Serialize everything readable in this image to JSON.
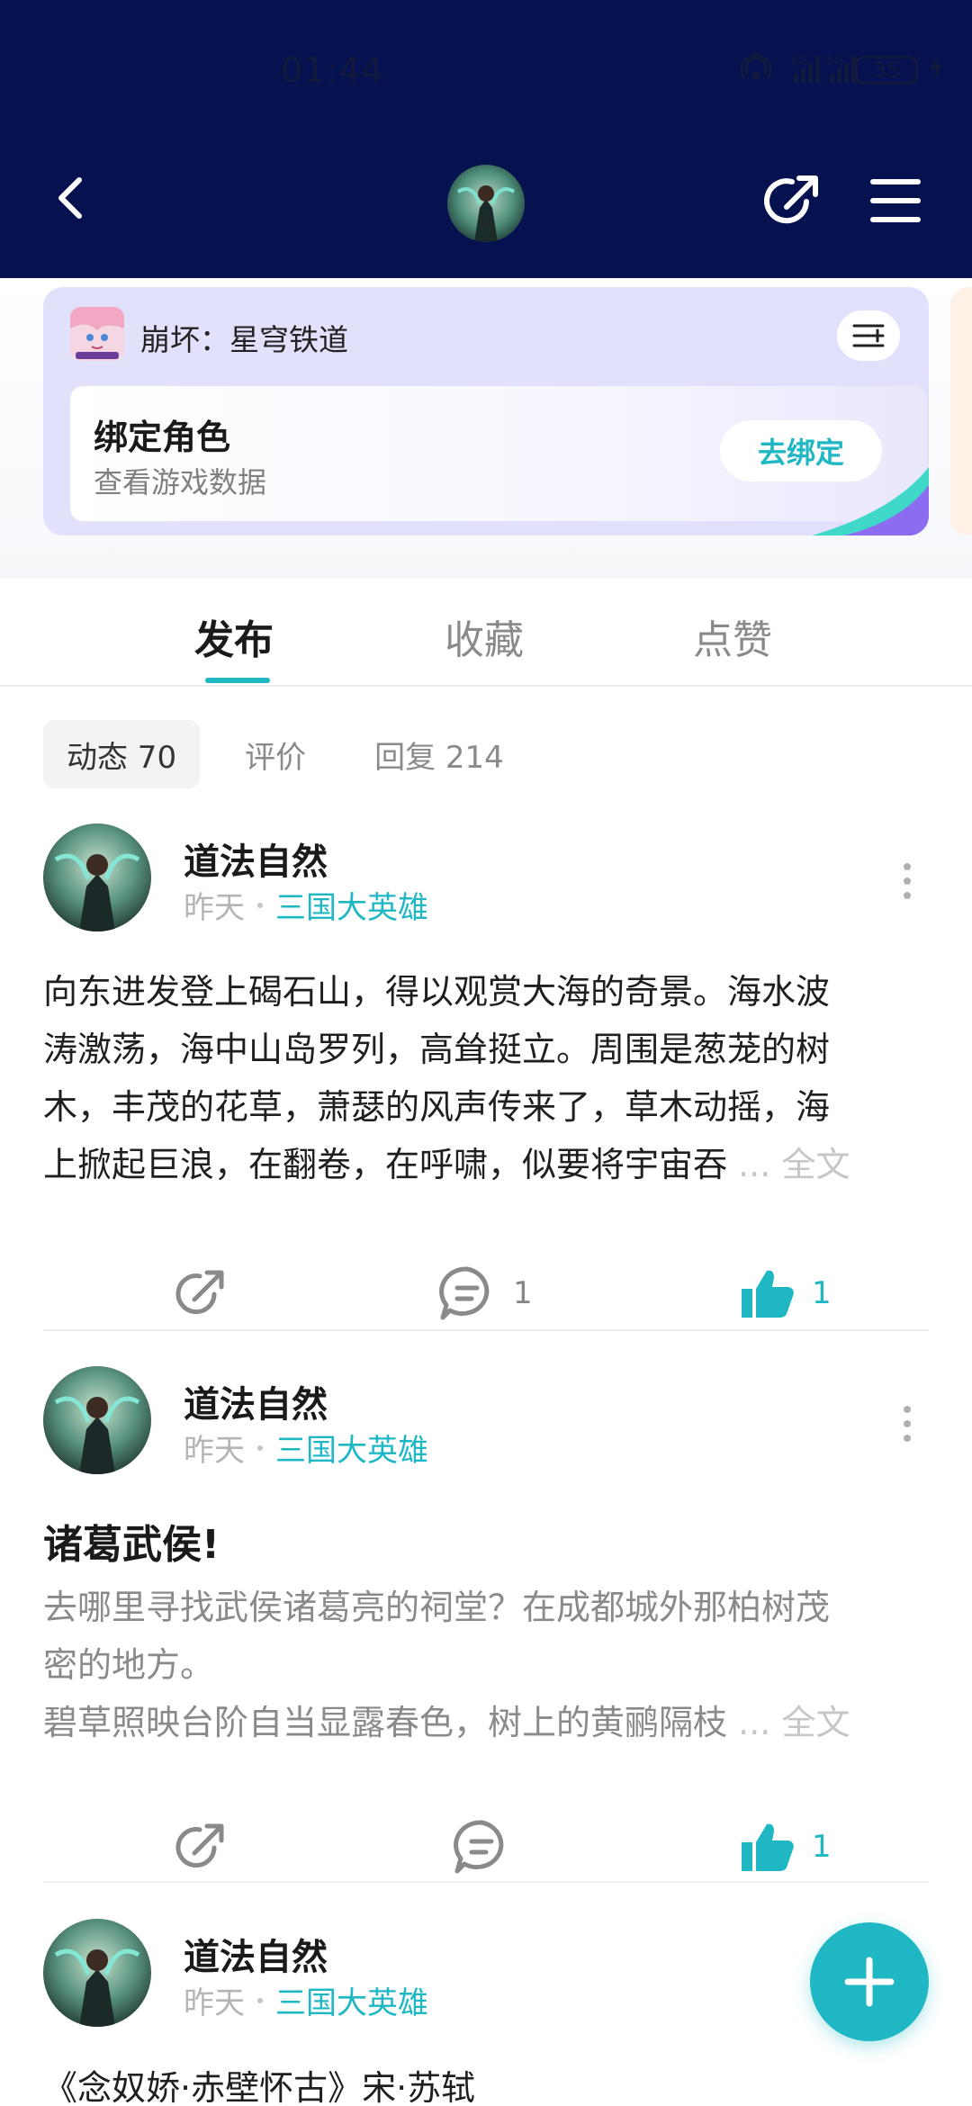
{
  "status": {
    "time": "01:44",
    "network_1": "4G",
    "network_2": "5G",
    "battery": "35"
  },
  "header": {
    "back_icon": "chevron-left-icon",
    "share_icon": "share-icon",
    "menu_icon": "menu-icon"
  },
  "bind_card": {
    "game_name": "崩坏：星穹铁道",
    "title": "绑定角色",
    "subtitle": "查看游戏数据",
    "button": "去绑定"
  },
  "main_tabs": [
    {
      "label": "发布",
      "active": true
    },
    {
      "label": "收藏",
      "active": false
    },
    {
      "label": "点赞",
      "active": false
    }
  ],
  "sub_tabs": [
    {
      "label": "动态 70",
      "active": true
    },
    {
      "label": "评价",
      "active": false
    },
    {
      "label": "回复 214",
      "active": false
    }
  ],
  "posts": [
    {
      "author": "道法自然",
      "time": "昨天",
      "game": "三国大英雄",
      "lines": [
        "向东进发登上碣石山，得以观赏大海的奇景。海水波",
        "涛激荡，海中山岛罗列，高耸挺立。周围是葱茏的树",
        "木，丰茂的花草，萧瑟的风声传来了，草木动摇，海",
        "上掀起巨浪，在翻卷，在呼啸，似要将宇宙吞"
      ],
      "ellipsis": "...",
      "fulltext": "全文",
      "comments": "1",
      "likes": "1"
    },
    {
      "author": "道法自然",
      "time": "昨天",
      "game": "三国大英雄",
      "title": "诸葛武侯!",
      "lines": [
        "去哪里寻找武侯诸葛亮的祠堂？在成都城外那柏树茂",
        "密的地方。",
        "碧草照映台阶自当显露春色，树上的黄鹂隔枝"
      ],
      "ellipsis": "...",
      "fulltext": "全文",
      "likes": "1"
    },
    {
      "author": "道法自然",
      "time": "昨天",
      "game": "三国大英雄",
      "lines": [
        "《念奴娇·赤壁怀古》宋·苏轼"
      ]
    }
  ],
  "colors": {
    "header_bg": "#06124f",
    "accent": "#1fb7c4",
    "card_bg": "#e2e1fb"
  },
  "fab_icon": "plus-icon"
}
